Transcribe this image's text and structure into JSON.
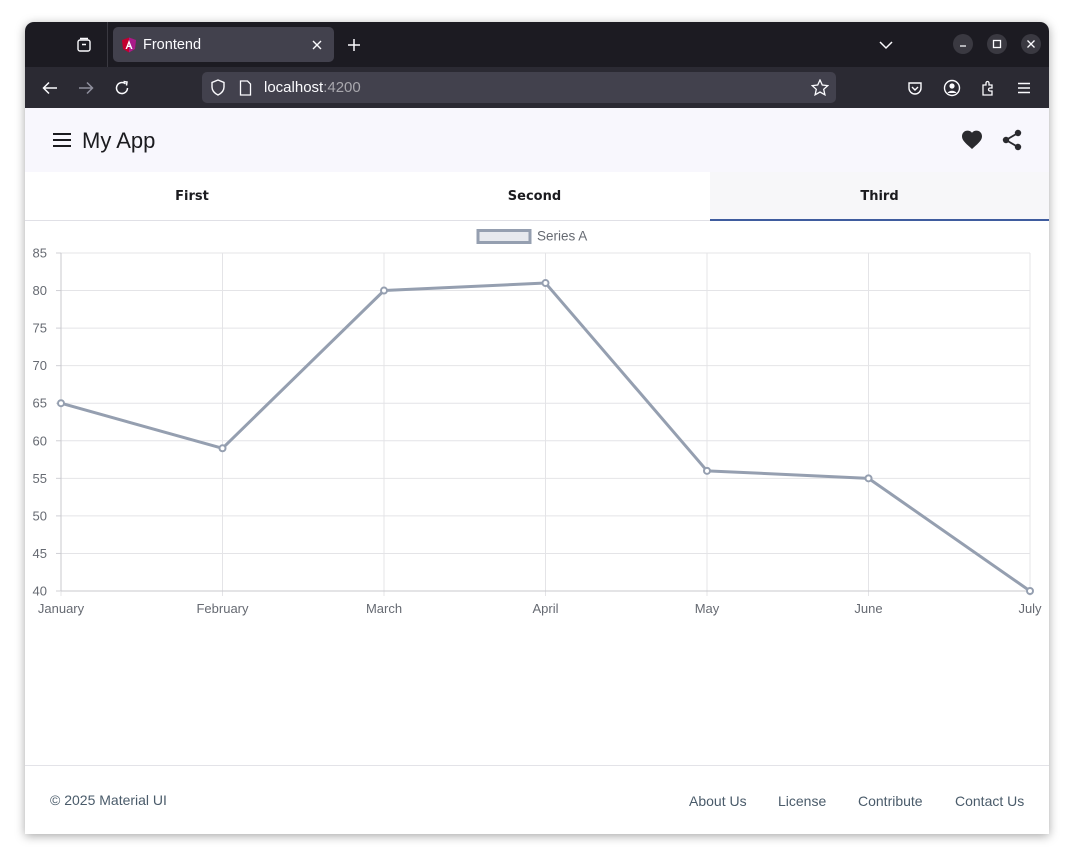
{
  "browser": {
    "tab_title": "Frontend",
    "url_host": "localhost",
    "url_port": ":4200"
  },
  "app": {
    "title": "My App",
    "tabs": [
      {
        "label": "First"
      },
      {
        "label": "Second"
      },
      {
        "label": "Third"
      }
    ],
    "active_tab": "Third"
  },
  "chart_data": {
    "type": "line",
    "categories": [
      "January",
      "February",
      "March",
      "April",
      "May",
      "June",
      "July"
    ],
    "series": [
      {
        "name": "Series A",
        "values": [
          65,
          59,
          80,
          81,
          56,
          55,
          40
        ],
        "color": "#959fb0"
      }
    ],
    "ylim": [
      40,
      85
    ],
    "yticks": [
      85,
      80,
      75,
      70,
      65,
      60,
      55,
      50,
      45,
      40
    ],
    "grid": true,
    "legend": "top-center"
  },
  "footer": {
    "copyright": "© 2025 Material UI",
    "links": [
      "About Us",
      "License",
      "Contribute",
      "Contact Us"
    ]
  },
  "colors": {
    "accent": "#3f5c9e",
    "line": "#959fb0",
    "toolbar_bg": "#f8f7fd",
    "browser_dark": "#1c1b22"
  }
}
